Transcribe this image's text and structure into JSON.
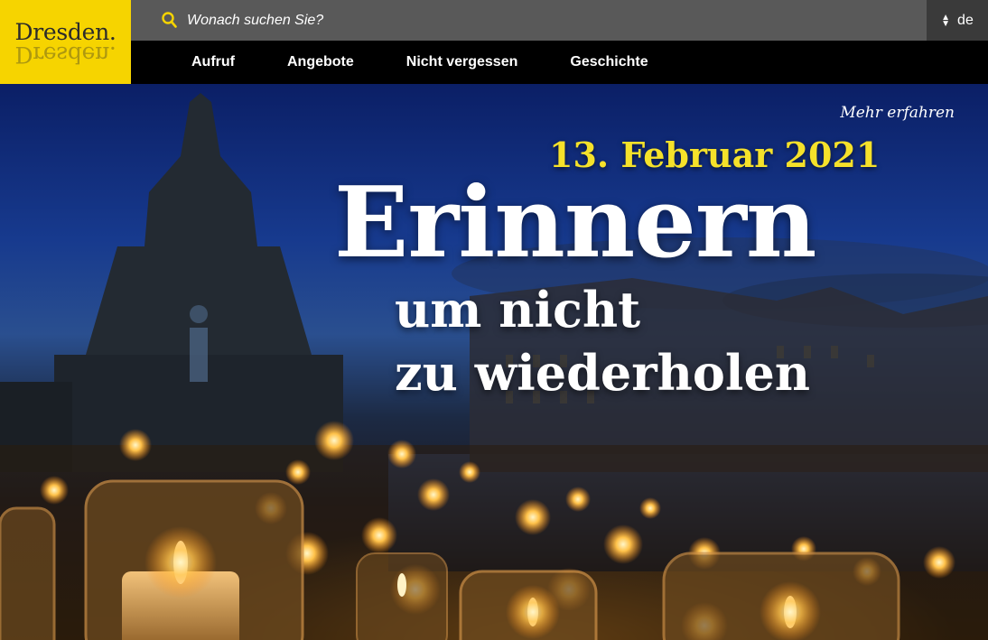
{
  "logo": {
    "text": "Dresden."
  },
  "search": {
    "placeholder": "Wonach suchen Sie?"
  },
  "language": {
    "current": "de"
  },
  "nav": {
    "items": [
      {
        "label": "Aufruf"
      },
      {
        "label": "Angebote"
      },
      {
        "label": "Nicht vergessen"
      },
      {
        "label": "Geschichte"
      }
    ]
  },
  "hero": {
    "more_link": "Mehr erfahren",
    "date": "13. Februar 2021",
    "headline": "Erinnern",
    "subline_1": "um nicht",
    "subline_2": "zu wiederholen"
  },
  "colors": {
    "brand_yellow": "#f6d400",
    "search_bar": "#595959",
    "date_yellow": "#f5e12a"
  },
  "icons": {
    "search": "search-icon",
    "language": "sort-arrows-icon"
  }
}
